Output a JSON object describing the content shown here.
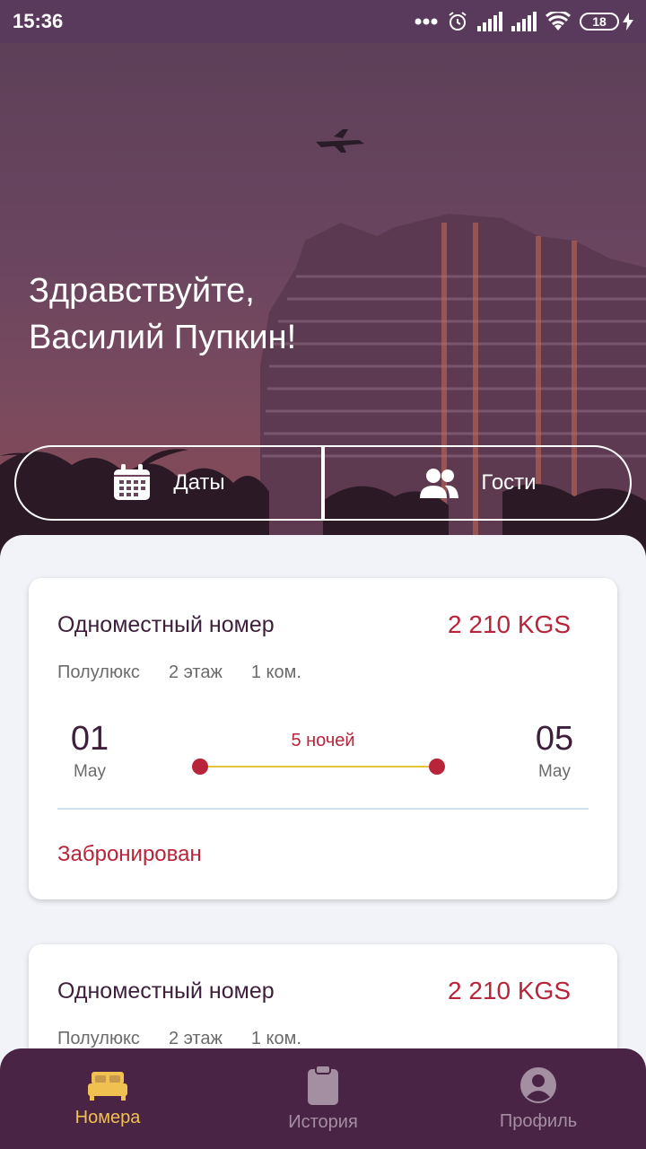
{
  "status_bar": {
    "time": "15:36",
    "battery": "18"
  },
  "hero": {
    "greeting_line1": "Здравствуйте,",
    "greeting_line2": "Василий Пупкин!",
    "dates_button": "Даты",
    "guests_button": "Гости"
  },
  "bookings": [
    {
      "title": "Одноместный номер",
      "price": "2 210 KGS",
      "category": "Полулюкс",
      "floor": "2 этаж",
      "rooms": "1 ком.",
      "start_day": "01",
      "start_month": "May",
      "nights": "5 ночей",
      "end_day": "05",
      "end_month": "May",
      "status": "Забронирован"
    },
    {
      "title": "Одноместный номер",
      "price": "2 210 KGS",
      "category": "Полулюкс",
      "floor": "2 этаж",
      "rooms": "1 ком."
    }
  ],
  "nav": {
    "items": [
      {
        "label": "Номера",
        "icon": "bed-icon",
        "active": true
      },
      {
        "label": "История",
        "icon": "clipboard-icon",
        "active": false
      },
      {
        "label": "Профиль",
        "icon": "user-circle-icon",
        "active": false
      }
    ]
  },
  "colors": {
    "accent": "#b8243a",
    "nav_bg": "#4a2444",
    "nav_active": "#f0c050",
    "timeline": "#e3c43f"
  }
}
